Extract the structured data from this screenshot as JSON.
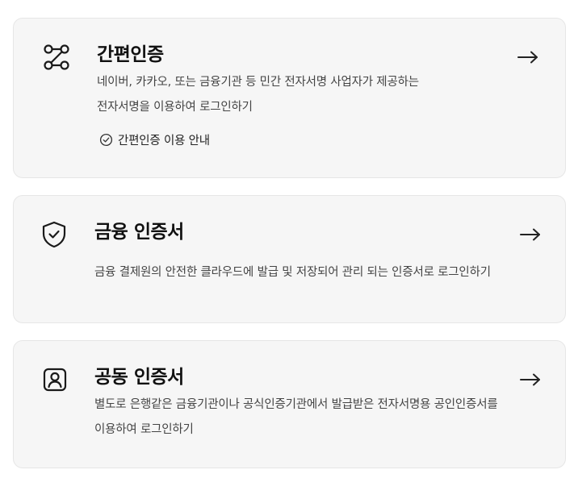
{
  "cards": [
    {
      "icon": "route-icon",
      "title": "간편인증",
      "desc_lines": [
        "네이버, 카카오, 또는 금융기관 등 민간 전자서명 사업자가 제공하는",
        "전자서명을 이용하여 로그인하기"
      ],
      "guide_icon": "check-circle-icon",
      "guide_label": "간편인증 이용 안내",
      "arrow_icon": "arrow-right-icon"
    },
    {
      "icon": "shield-check-icon",
      "title": "금융 인증서",
      "desc_lines": [
        "금융 결제원의 안전한 클라우드에 발급 및 저장되어 관리 되는 인증서로 로그인하기"
      ],
      "arrow_icon": "arrow-right-icon"
    },
    {
      "icon": "user-badge-icon",
      "title": "공동 인증서",
      "desc_lines": [
        "별도로 은행같은 금융기관이나 공식인증기관에서 발급받은 전자서명용 공인인증서를",
        "이용하여 로그인하기"
      ],
      "arrow_icon": "arrow-right-icon"
    }
  ]
}
